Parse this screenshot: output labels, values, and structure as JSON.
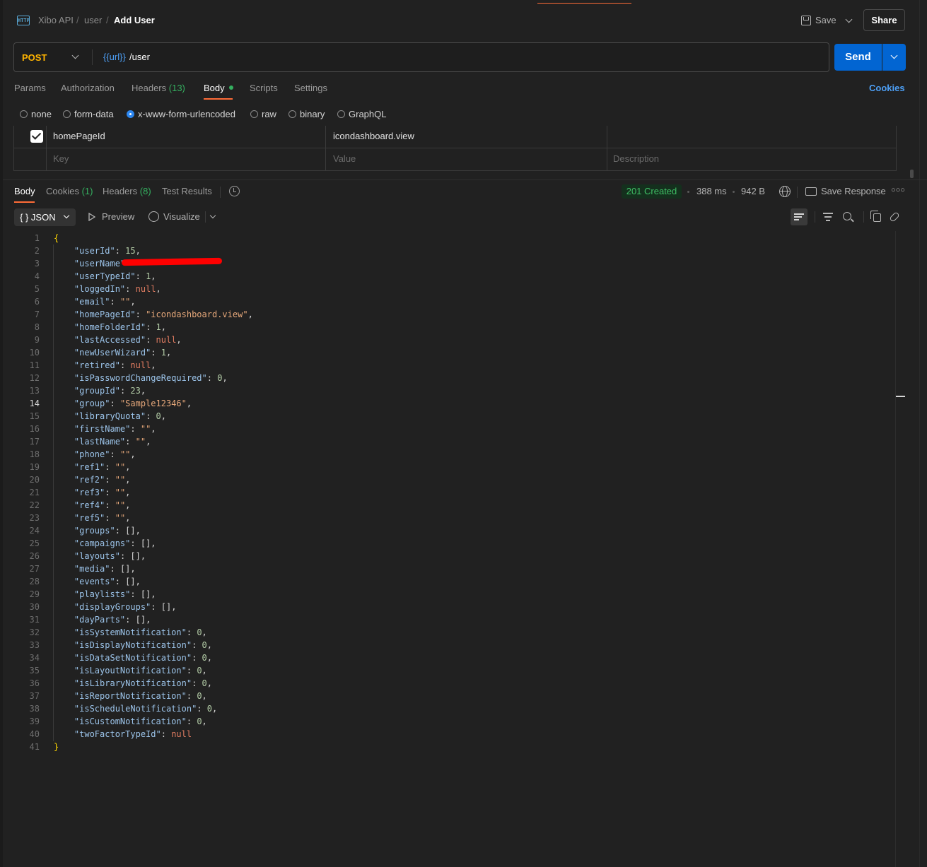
{
  "breadcrumb": {
    "icon": "http-icon",
    "items": [
      "Xibo API",
      "user",
      "Add User"
    ],
    "separator": "/"
  },
  "header": {
    "save_label": "Save",
    "share_label": "Share"
  },
  "request": {
    "method": "POST",
    "method_color": "#ffb400",
    "url_variable": "{{url}}",
    "url_path": "/user",
    "send_label": "Send"
  },
  "request_tabs": {
    "params": "Params",
    "authorization": "Authorization",
    "headers": "Headers",
    "headers_count": "(13)",
    "body": "Body",
    "scripts": "Scripts",
    "settings": "Settings",
    "cookies": "Cookies"
  },
  "body_types": {
    "none": "none",
    "form_data": "form-data",
    "urlencoded": "x-www-form-urlencoded",
    "raw": "raw",
    "binary": "binary",
    "graphql": "GraphQL",
    "selected": "x-www-form-urlencoded"
  },
  "kv_rows": {
    "row1_key": "homePageId",
    "row1_value": "icondashboard.view",
    "placeholder_key": "Key",
    "placeholder_value": "Value",
    "placeholder_description": "Description"
  },
  "response_tabs": {
    "body": "Body",
    "cookies": "Cookies",
    "cookies_count": "(1)",
    "headers": "Headers",
    "headers_count": "(8)",
    "test_results": "Test Results"
  },
  "response_meta": {
    "status": "201 Created",
    "time": "388 ms",
    "size": "942 B",
    "save_response": "Save Response"
  },
  "response_toolbar": {
    "format": "JSON",
    "format_icon": "{ }",
    "preview": "Preview",
    "visualize": "Visualize"
  },
  "colors": {
    "accent": "#ff6c37",
    "send_blue": "#0265d2",
    "status_green": "#3fbf65",
    "link_blue": "#4d9ff5"
  },
  "code": {
    "current_line": 14,
    "lines": [
      "{",
      "    \"userId\": 15,",
      "    \"userName\"",
      "    \"userTypeId\": 1,",
      "    \"loggedIn\": null,",
      "    \"email\": \"\",",
      "    \"homePageId\": \"icondashboard.view\",",
      "    \"homeFolderId\": 1,",
      "    \"lastAccessed\": null,",
      "    \"newUserWizard\": 1,",
      "    \"retired\": null,",
      "    \"isPasswordChangeRequired\": 0,",
      "    \"groupId\": 23,",
      "    \"group\": \"Sample12346\",",
      "    \"libraryQuota\": 0,",
      "    \"firstName\": \"\",",
      "    \"lastName\": \"\",",
      "    \"phone\": \"\",",
      "    \"ref1\": \"\",",
      "    \"ref2\": \"\",",
      "    \"ref3\": \"\",",
      "    \"ref4\": \"\",",
      "    \"ref5\": \"\",",
      "    \"groups\": [],",
      "    \"campaigns\": [],",
      "    \"layouts\": [],",
      "    \"media\": [],",
      "    \"events\": [],",
      "    \"playlists\": [],",
      "    \"displayGroups\": [],",
      "    \"dayParts\": [],",
      "    \"isSystemNotification\": 0,",
      "    \"isDisplayNotification\": 0,",
      "    \"isDataSetNotification\": 0,",
      "    \"isLayoutNotification\": 0,",
      "    \"isLibraryNotification\": 0,",
      "    \"isReportNotification\": 0,",
      "    \"isScheduleNotification\": 0,",
      "    \"isCustomNotification\": 0,",
      "    \"twoFactorTypeId\": null",
      "}"
    ]
  }
}
